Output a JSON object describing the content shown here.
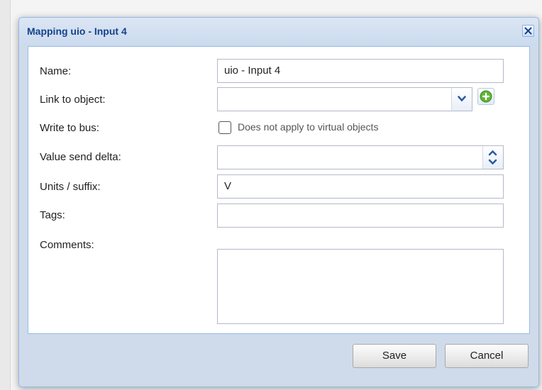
{
  "dialog": {
    "title": "Mapping uio - Input 4",
    "close_icon": "close-icon"
  },
  "form": {
    "name_label": "Name:",
    "name_value": "uio - Input 4",
    "link_label": "Link to object:",
    "link_value": "",
    "write_label": "Write to bus:",
    "write_checked": false,
    "write_note": "Does not apply to virtual objects",
    "delta_label": "Value send delta:",
    "delta_value": "",
    "units_label": "Units / suffix:",
    "units_value": "V",
    "tags_label": "Tags:",
    "tags_value": "",
    "comments_label": "Comments:",
    "comments_value": ""
  },
  "buttons": {
    "save": "Save",
    "cancel": "Cancel"
  },
  "colors": {
    "title_text": "#15428b",
    "dialog_frame": "#cfdbea",
    "add_button_green": "#5fb336"
  }
}
